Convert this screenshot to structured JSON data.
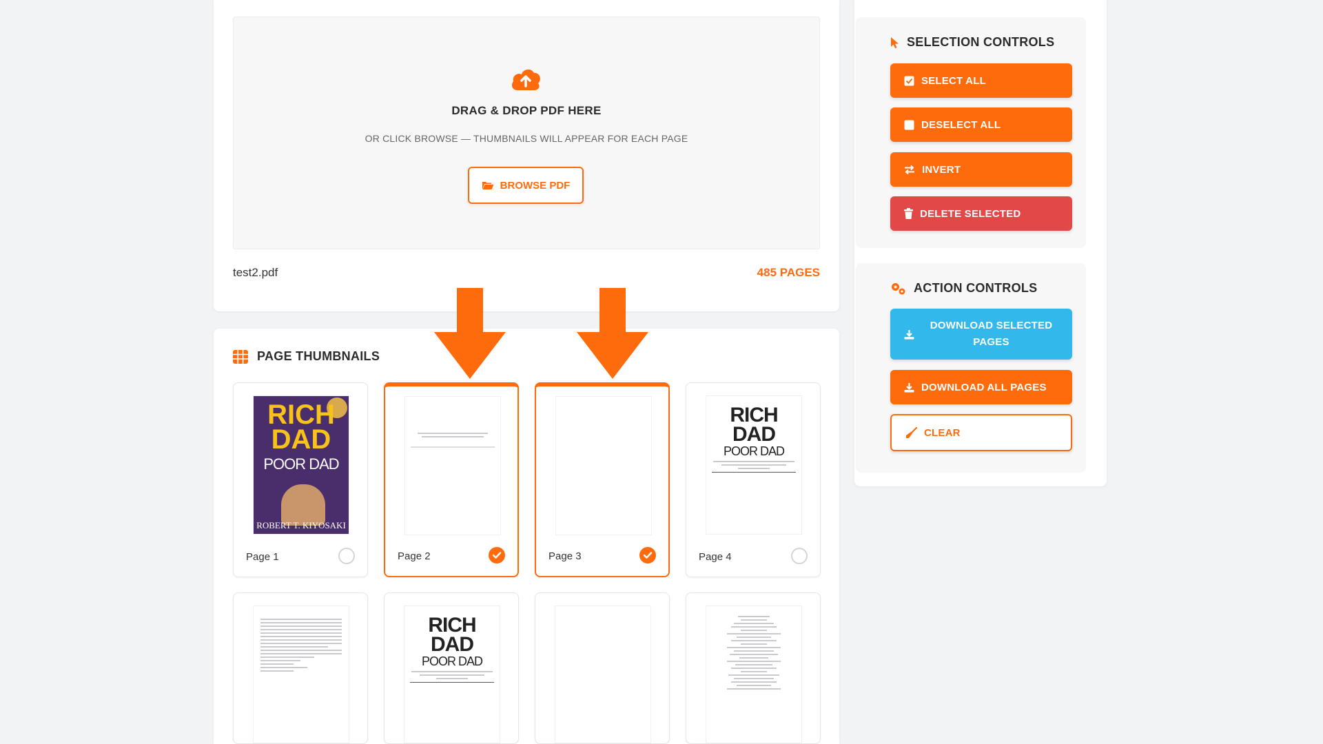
{
  "upload": {
    "title": "DRAG & DROP PDF HERE",
    "subtitle": "OR CLICK BROWSE — THUMBNAILS WILL APPEAR FOR EACH PAGE",
    "browse_label": "BROWSE PDF",
    "icon": "cloud-upload-icon"
  },
  "file": {
    "name": "test2.pdf",
    "page_count": "485 PAGES"
  },
  "thumbnails": {
    "title": "PAGE THUMBNAILS",
    "pages": [
      {
        "label": "Page 1",
        "selected": false
      },
      {
        "label": "Page 2",
        "selected": true
      },
      {
        "label": "Page 3",
        "selected": true
      },
      {
        "label": "Page 4",
        "selected": false
      }
    ],
    "cover": {
      "line1": "RICH",
      "line2": "DAD",
      "line3": "POOR DAD",
      "author": "ROBERT T. KIYOSAKI"
    },
    "title_page": {
      "line1": "RICH",
      "line2": "DAD",
      "line3": "POOR DAD"
    }
  },
  "selection_controls": {
    "title": "SELECTION CONTROLS",
    "select_all": "SELECT ALL",
    "deselect_all": "DESELECT ALL",
    "invert": "INVERT",
    "delete_selected": "DELETE SELECTED"
  },
  "action_controls": {
    "title": "ACTION CONTROLS",
    "download_selected_line1": "DOWNLOAD SELECTED",
    "download_selected_line2": "PAGES",
    "download_all": "DOWNLOAD ALL PAGES",
    "clear": "CLEAR"
  },
  "colors": {
    "accent": "#fd6b0d",
    "danger": "#e34848",
    "info": "#32b8eb",
    "background": "#f2f3f5"
  }
}
